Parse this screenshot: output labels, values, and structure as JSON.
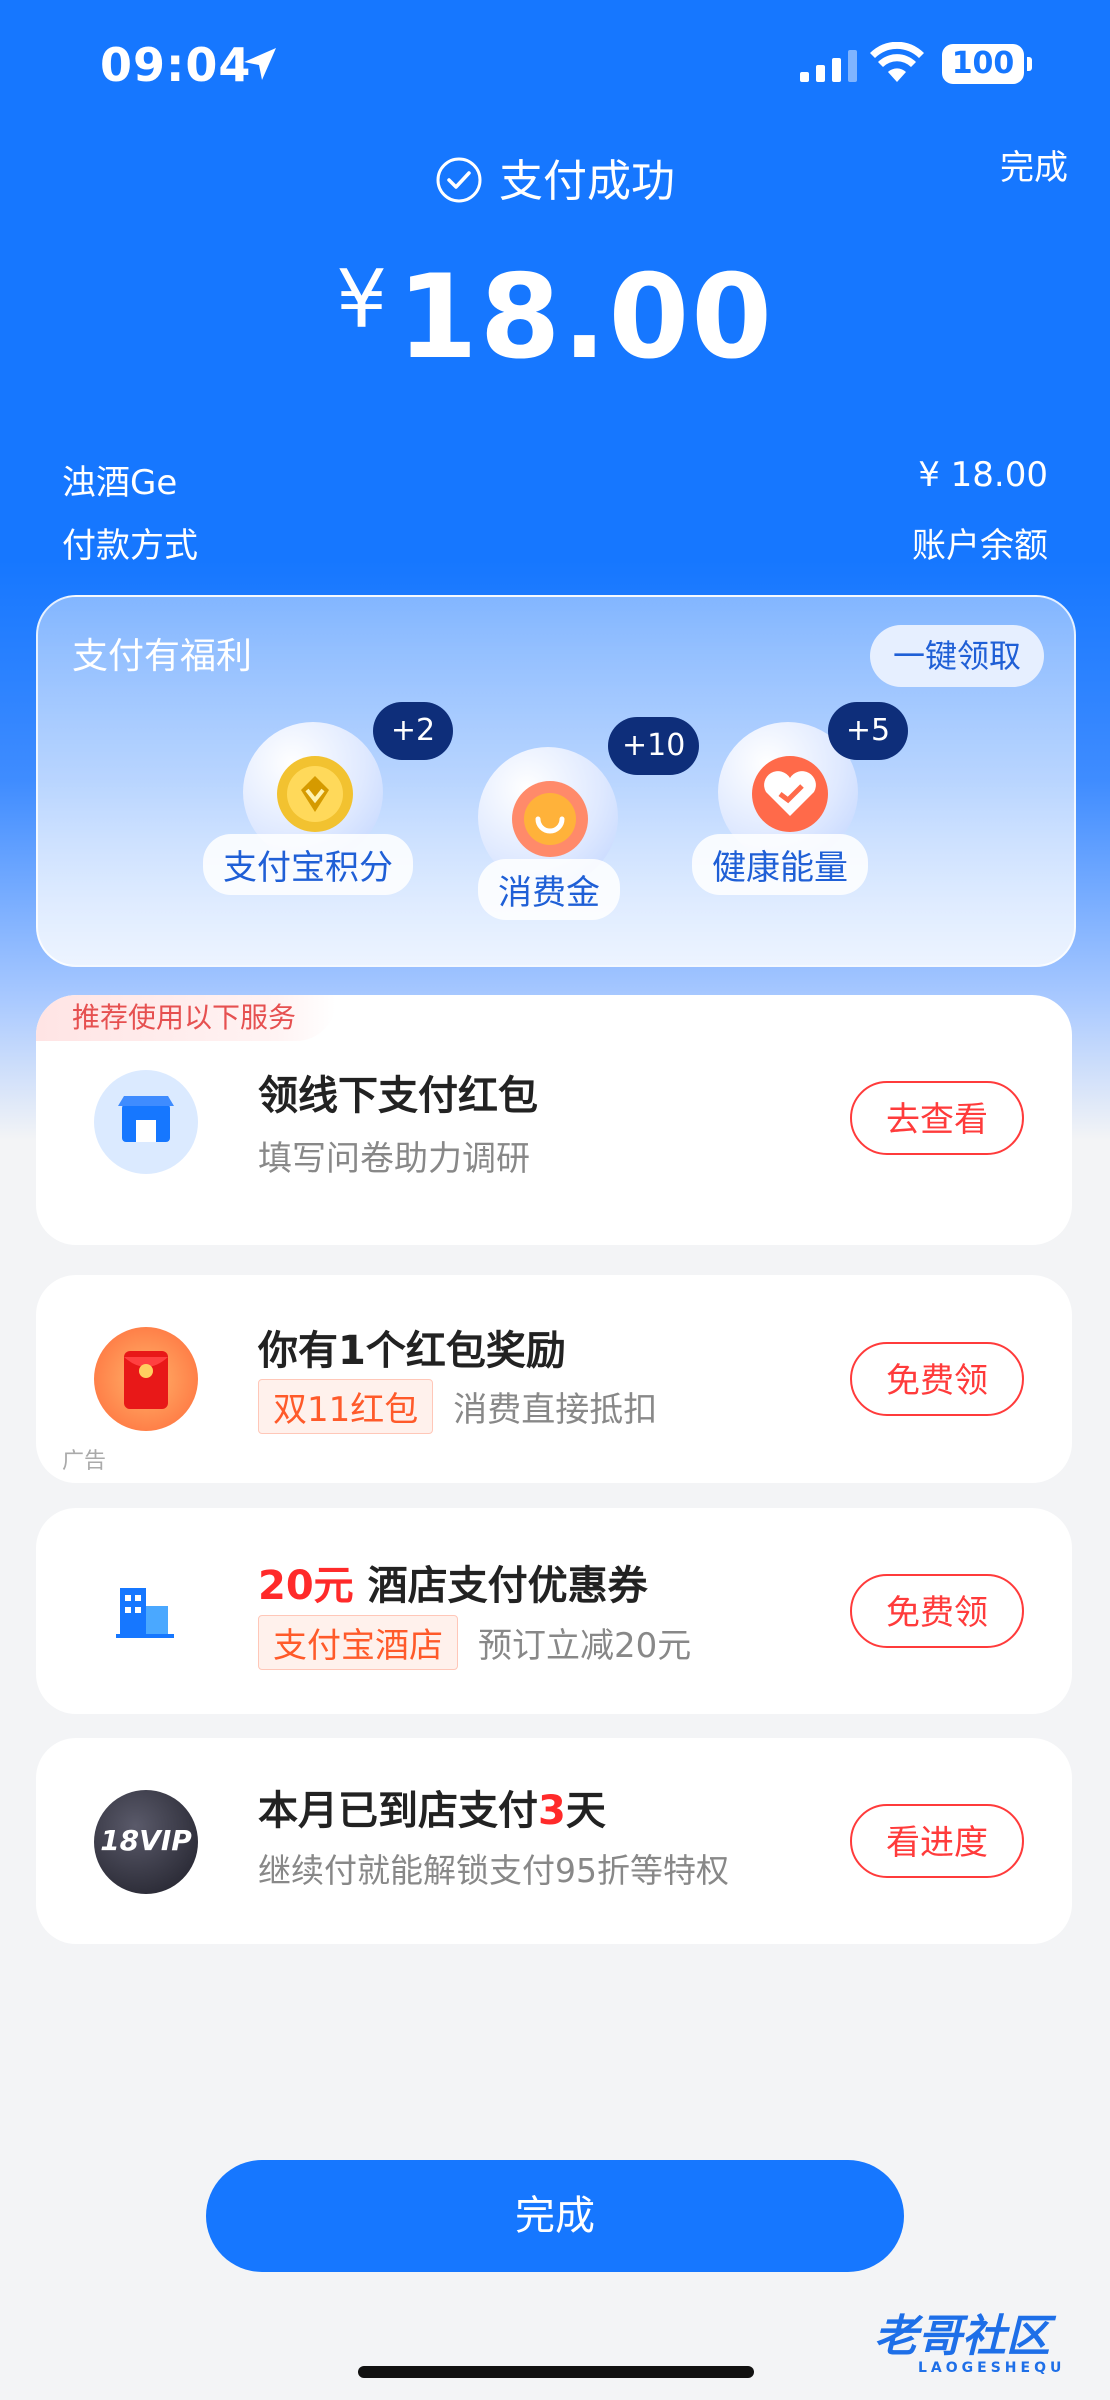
{
  "status_bar": {
    "time": "09:04",
    "battery": "100"
  },
  "header": {
    "done_label": "完成",
    "title": "支付成功"
  },
  "payment": {
    "currency_symbol": "¥",
    "amount": "18.00",
    "merchant": "浊酒Ge",
    "merchant_amount": "¥ 18.00",
    "method_label": "付款方式",
    "method_value": "账户余额"
  },
  "benefits": {
    "title": "支付有福利",
    "claim_all": "一键领取",
    "items": [
      {
        "label": "支付宝积分",
        "bonus": "+2",
        "icon": "points-coin-icon"
      },
      {
        "label": "消费金",
        "bonus": "+10",
        "icon": "consumption-coin-icon"
      },
      {
        "label": "健康能量",
        "bonus": "+5",
        "icon": "health-energy-icon"
      }
    ]
  },
  "services": {
    "section_label": "推荐使用以下服务",
    "cards": [
      {
        "title": "领线下支付红包",
        "subtitle": "填写问卷助力调研",
        "button": "去查看",
        "icon": "store-icon"
      },
      {
        "title": "你有1个红包奖励",
        "tag": "双11红包",
        "subtitle": "消费直接抵扣",
        "button": "免费领",
        "ad_label": "广告",
        "icon": "red-envelope-icon"
      },
      {
        "title_highlight": "20元",
        "title": "酒店支付优惠券",
        "tag": "支付宝酒店",
        "subtitle": "预订立减20元",
        "button": "免费领",
        "icon": "hotel-icon"
      },
      {
        "title_prefix": "本月已到店支付",
        "title_highlight": "3",
        "title_suffix": "天",
        "subtitle": "继续付就能解锁支付95折等特权",
        "button": "看进度",
        "icon": "vip-badge-icon",
        "badge_text": "18VIP"
      }
    ]
  },
  "footer": {
    "done_button": "完成"
  },
  "watermark": {
    "text": "老哥社区",
    "sub": "LAOGESHEQU"
  },
  "colors": {
    "primary": "#1677ff",
    "accent_red": "#ff3b3b"
  }
}
